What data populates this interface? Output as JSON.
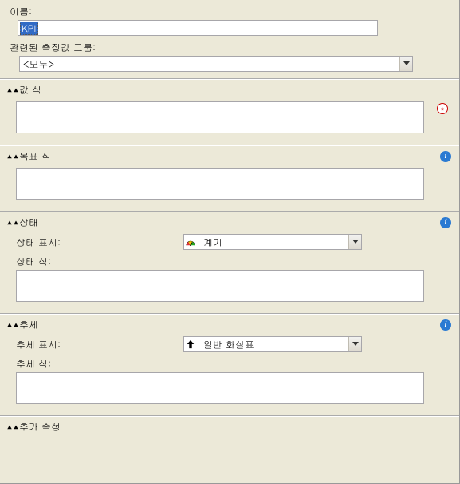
{
  "nameField": {
    "label": "이름:",
    "value": "KPI"
  },
  "measureGroup": {
    "label": "관련된 측정값 그룹:",
    "selected": "<모두>"
  },
  "sections": {
    "value": {
      "title": "값 식",
      "expr": ""
    },
    "goal": {
      "title": "목표 식",
      "expr": ""
    },
    "status": {
      "title": "상태",
      "indicatorLabel": "상태 표시:",
      "indicatorSelected": "계기",
      "exprLabel": "상태 식:",
      "expr": ""
    },
    "trend": {
      "title": "추세",
      "indicatorLabel": "추세 표시:",
      "indicatorSelected": "일반 화살표",
      "exprLabel": "추세 식:",
      "expr": ""
    },
    "additional": {
      "title": "추가 속성"
    }
  },
  "icons": {
    "collapse": "«",
    "info": "i",
    "required": "*"
  }
}
